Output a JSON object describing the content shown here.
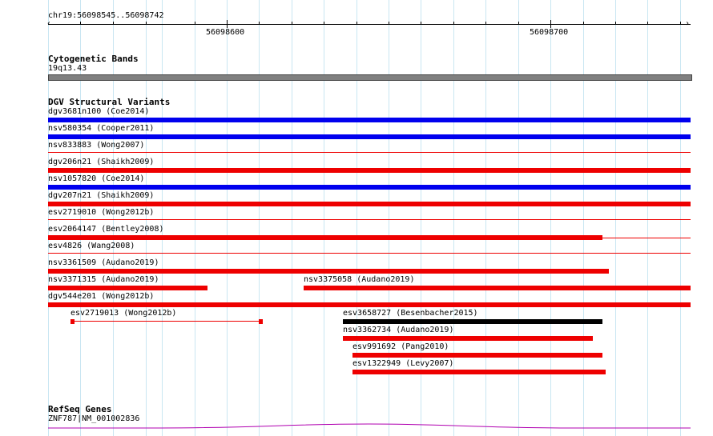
{
  "ruler": {
    "location": "chr19:56098545..56098742",
    "tick_major_1": "56098600",
    "tick_major_2": "56098700"
  },
  "cytoband": {
    "title": "Cytogenetic Bands",
    "band": "19q13.43",
    "color": "#808080"
  },
  "dgv": {
    "title": "DGV Structural Variants",
    "colors": {
      "gain": "#0000ee",
      "loss": "#ee0000",
      "complex": "#000000"
    },
    "features": [
      {
        "label": "dgv3681n100 (Coe2014)",
        "color": "blue"
      },
      {
        "label": "nsv580354 (Cooper2011)",
        "color": "blue"
      },
      {
        "label": "nsv833883 (Wong2007)",
        "color": "red"
      },
      {
        "label": "dgv206n21 (Shaikh2009)",
        "color": "red"
      },
      {
        "label": "nsv1057820 (Coe2014)",
        "color": "blue"
      },
      {
        "label": "dgv207n21 (Shaikh2009)",
        "color": "red"
      },
      {
        "label": "esv2719010 (Wong2012b)",
        "color": "red"
      },
      {
        "label": "esv2064147 (Bentley2008)",
        "color": "red"
      },
      {
        "label": "esv4826 (Wang2008)",
        "color": "red"
      },
      {
        "label": "nsv3361509 (Audano2019)",
        "color": "red"
      },
      {
        "label": "nsv3371315 (Audano2019)",
        "color": "red"
      },
      {
        "label": "nsv3375058 (Audano2019)",
        "color": "red"
      },
      {
        "label": "dgv544e201 (Wong2012b)",
        "color": "red"
      },
      {
        "label": "esv2719013 (Wong2012b)",
        "color": "red"
      },
      {
        "label": "esv3658727 (Besenbacher2015)",
        "color": "black"
      },
      {
        "label": "nsv3362734 (Audano2019)",
        "color": "red"
      },
      {
        "label": "esv991692 (Pang2010)",
        "color": "red"
      },
      {
        "label": "esv1322949 (Levy2007)",
        "color": "red"
      }
    ]
  },
  "refseq": {
    "title": "RefSeq Genes",
    "gene": "ZNF787|NM_001002836",
    "color": "#b000b0"
  }
}
